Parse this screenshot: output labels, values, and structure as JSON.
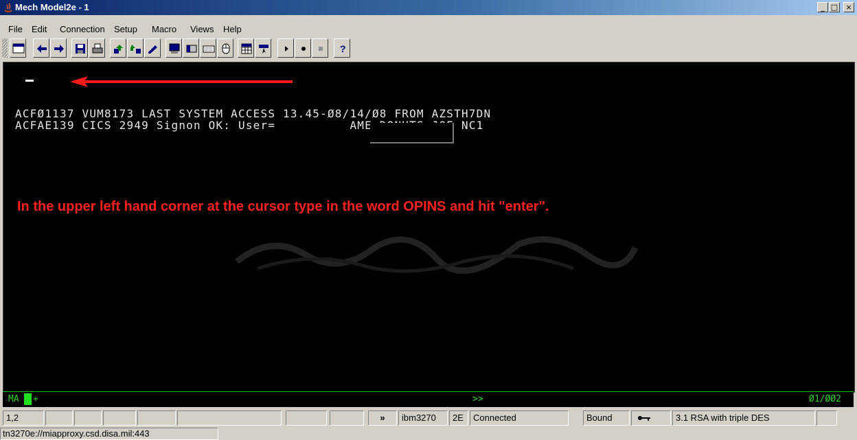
{
  "window": {
    "title": "Mech Model2e - 1",
    "controls": {
      "minimize": "_",
      "maximize": "□",
      "close": "×"
    }
  },
  "menu": [
    "File",
    "Edit",
    "Connection",
    "Setup",
    "Macro",
    "Views",
    "Help"
  ],
  "toolbar_icons": [
    "window-icon",
    "back-arrow-icon",
    "forward-arrow-icon",
    "save-icon",
    "print-icon",
    "send-file-icon",
    "receive-file-icon",
    "edit-icon",
    "display-icon",
    "keypad-icon",
    "keyboard-icon",
    "mouse-icon",
    "grid-icon",
    "hotspot-icon",
    "play-macro-icon",
    "record-macro-icon",
    "stop-macro-icon",
    "help-icon"
  ],
  "terminal": {
    "lines": [
      "ACFØ1137 VUM8173 LAST SYSTEM ACCESS 13.45-Ø8/14/Ø8 FROM AZSTH7DN",
      "ACFAE139 CICS 2949 Signon OK: User=          AME=DONUTS JOE NC1"
    ],
    "instruction": "In the upper left hand corner at the cursor type in the word OPINS and hit \"enter\".",
    "arrow_color": "#ff1a1a"
  },
  "oia": {
    "left": "MA",
    "plus": "+",
    "center": ">>",
    "right": "Ø1/ØØ2"
  },
  "status": {
    "cursor_pos": "1,2",
    "arrows": "»",
    "terminal_type": "ibm3270",
    "model": "2E",
    "connection": "Connected",
    "bound": "Bound",
    "encryption": "3.1 RSA with triple DES"
  },
  "url": "tn3270e://miapproxy.csd.disa.mil:443"
}
